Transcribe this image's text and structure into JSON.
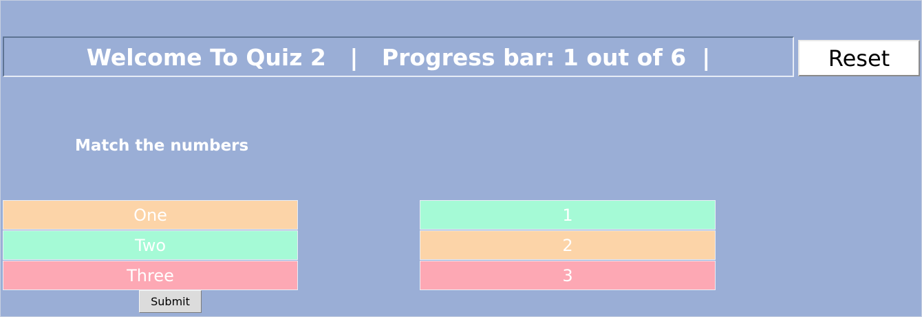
{
  "header": {
    "title": "Welcome To Quiz 2   |   Progress bar: 1 out of 6  |"
  },
  "reset_label": "Reset",
  "prompt": "Match the numbers",
  "left_items": [
    {
      "label": "One",
      "color": "#fcd4a8"
    },
    {
      "label": "Two",
      "color": "#a5fad6"
    },
    {
      "label": "Three",
      "color": "#fda8b4"
    }
  ],
  "right_items": [
    {
      "label": "1",
      "color": "#a5fad6"
    },
    {
      "label": "2",
      "color": "#fcd4a8"
    },
    {
      "label": "3",
      "color": "#fda8b4"
    }
  ],
  "submit_label": "Submit",
  "colors": {
    "background": "#9aaed6",
    "peach": "#fcd4a8",
    "mint": "#a5fad6",
    "pink": "#fda8b4"
  }
}
